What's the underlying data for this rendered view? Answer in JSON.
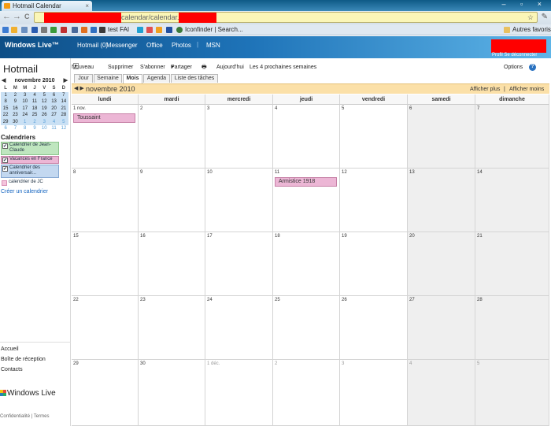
{
  "browser": {
    "tab_title": "Hotmail Calendar",
    "tab_close": "×",
    "window_controls": "– ▫ ×",
    "url_visible": "calendar/calendar.",
    "back": "←",
    "forward": "→",
    "reload": "C",
    "star": "☆",
    "wrench": "✎",
    "bookmarks": [
      "test FAI",
      "Iconfinder | Search..."
    ],
    "other_bookmarks": "Autres favoris"
  },
  "live_header": {
    "logo": "Windows Live™",
    "nav": [
      "Hotmail (0)",
      "Messenger",
      "Office",
      "Photos",
      "MSN"
    ],
    "separator": "|",
    "signout": "Profil  Se déconnecter"
  },
  "sidebar": {
    "title": "Hotmail",
    "mini_calendar": {
      "month": "novembre 2010",
      "prev": "◀",
      "next": "▶",
      "weekdays": [
        "L",
        "M",
        "M",
        "J",
        "V",
        "S",
        "D"
      ],
      "weeks": [
        [
          "1",
          "2",
          "3",
          "4",
          "5",
          "6",
          "7"
        ],
        [
          "8",
          "9",
          "10",
          "11",
          "12",
          "13",
          "14"
        ],
        [
          "15",
          "16",
          "17",
          "18",
          "19",
          "20",
          "21"
        ],
        [
          "22",
          "23",
          "24",
          "25",
          "26",
          "27",
          "28"
        ],
        [
          "29",
          "30",
          "1",
          "2",
          "3",
          "4",
          "5"
        ],
        [
          "6",
          "7",
          "8",
          "9",
          "10",
          "11",
          "12"
        ]
      ]
    },
    "calendars_title": "Calendriers",
    "calendars": [
      {
        "label": "Calendrier de Jean-Claude",
        "checked": true,
        "color": "#bfe6bf",
        "border": "#8cc48c"
      },
      {
        "label": "Vacances en France",
        "checked": true,
        "color": "#ecb6d5",
        "border": "#c680a6"
      },
      {
        "label": "Calendrier des anniversair...",
        "checked": true,
        "color": "#c3d8f0",
        "border": "#86a8d2"
      },
      {
        "label": "calendrier de JC",
        "checked": false,
        "color": "#f4c4dc",
        "border": "#d890b6"
      }
    ],
    "create_link": "Créer un calendrier",
    "bottom_links": [
      "Accueil",
      "Boîte de réception",
      "Contacts"
    ],
    "wl_logo": "Windows Live",
    "footer": "Confidentialité | Termes"
  },
  "toolbar": {
    "new": "Nouveau",
    "dd": "▾",
    "delete": "Supprimer",
    "subscribe": "S'abonner",
    "share": "Partager",
    "print_icon": "🖶",
    "today": "Aujourd'hui",
    "next_weeks": "Les 4 prochaines semaines",
    "options": "Options",
    "help": "?"
  },
  "view_tabs": [
    "Jour",
    "Semaine",
    "Mois",
    "Agenda",
    "Liste des tâches"
  ],
  "active_tab": 2,
  "calendar": {
    "arrows": "◀ ▶",
    "month_title": "novembre 2010",
    "show_more": "Afficher plus",
    "link_sep": "|",
    "show_less": "Afficher moins",
    "weekdays": [
      "lundi",
      "mardi",
      "mercredi",
      "jeudi",
      "vendredi",
      "samedi",
      "dimanche"
    ],
    "weeks": [
      [
        {
          "d": "1 nov."
        },
        {
          "d": "2"
        },
        {
          "d": "3"
        },
        {
          "d": "4"
        },
        {
          "d": "5"
        },
        {
          "d": "6"
        },
        {
          "d": "7"
        }
      ],
      [
        {
          "d": "8"
        },
        {
          "d": "9"
        },
        {
          "d": "10"
        },
        {
          "d": "11"
        },
        {
          "d": "12"
        },
        {
          "d": "13"
        },
        {
          "d": "14"
        }
      ],
      [
        {
          "d": "15"
        },
        {
          "d": "16"
        },
        {
          "d": "17"
        },
        {
          "d": "18"
        },
        {
          "d": "19"
        },
        {
          "d": "20"
        },
        {
          "d": "21"
        }
      ],
      [
        {
          "d": "22"
        },
        {
          "d": "23"
        },
        {
          "d": "24"
        },
        {
          "d": "25"
        },
        {
          "d": "26"
        },
        {
          "d": "27"
        },
        {
          "d": "28"
        }
      ],
      [
        {
          "d": "29"
        },
        {
          "d": "30"
        },
        {
          "d": "1 déc.",
          "other": true
        },
        {
          "d": "2",
          "other": true
        },
        {
          "d": "3",
          "other": true
        },
        {
          "d": "4",
          "other": true
        },
        {
          "d": "5",
          "other": true
        }
      ]
    ],
    "events": [
      {
        "week": 0,
        "day": 0,
        "title": "Toussaint"
      },
      {
        "week": 1,
        "day": 3,
        "title": "Armistice 1918"
      }
    ]
  }
}
